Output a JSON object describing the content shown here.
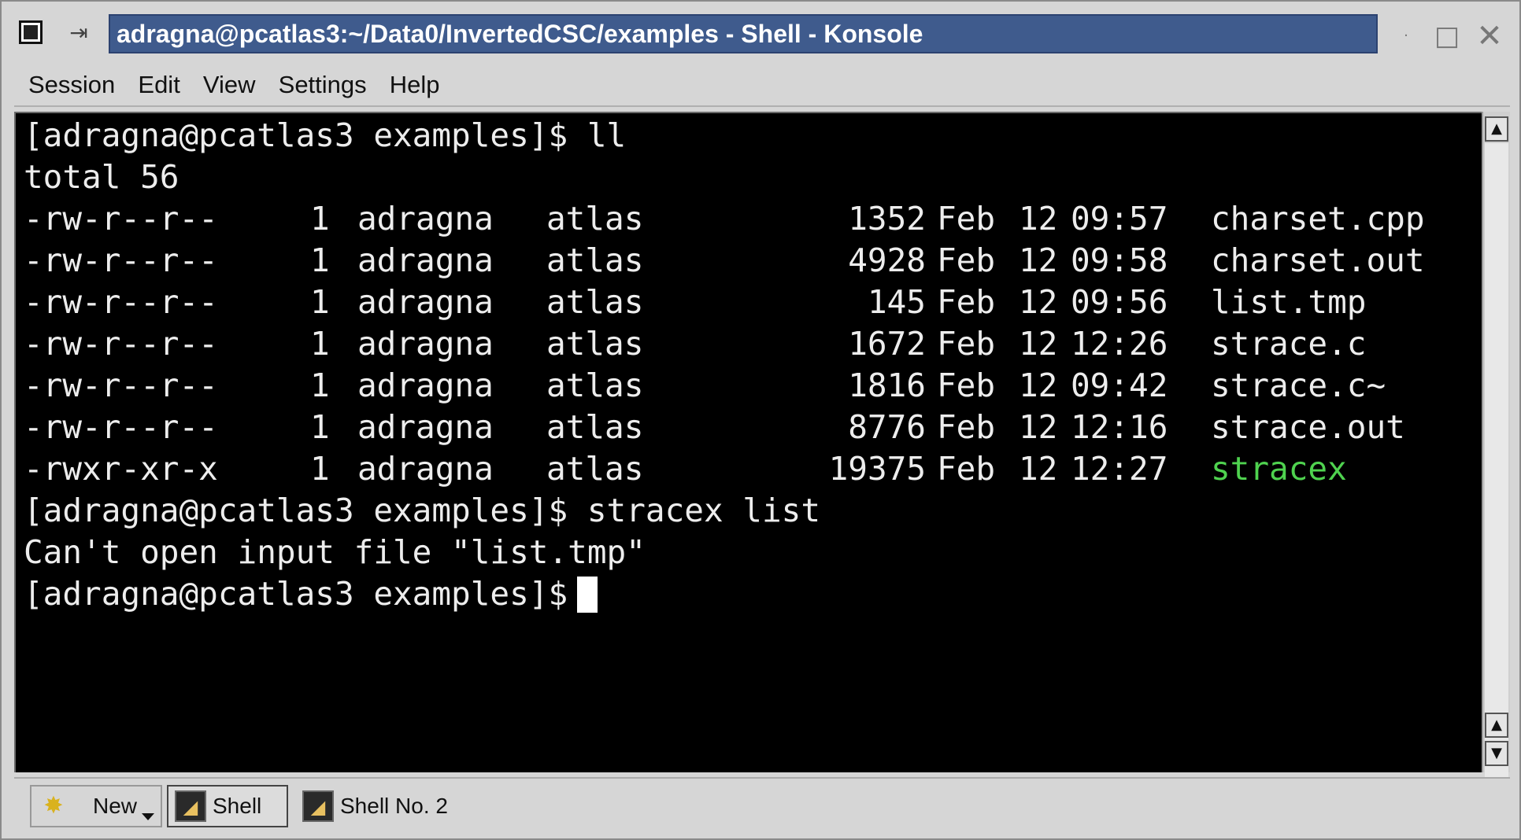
{
  "window": {
    "title": "adragna@pcatlas3:~/Data0/InvertedCSC/examples - Shell - Konsole",
    "minimize_glyph": "·",
    "maximize_glyph": "□",
    "close_glyph": "✕",
    "pin_glyph": "⇥"
  },
  "menu": [
    "Session",
    "Edit",
    "View",
    "Settings",
    "Help"
  ],
  "terminal": {
    "prompt_cmd1": "[adragna@pcatlas3 examples]$ ll",
    "total": "total 56",
    "files": [
      {
        "perm": "-rw-r--r--",
        "links": "1",
        "owner": "adragna",
        "group": "atlas",
        "size": "1352",
        "month": "Feb",
        "day": "12",
        "time": "09:57",
        "name": "charset.cpp"
      },
      {
        "perm": "-rw-r--r--",
        "links": "1",
        "owner": "adragna",
        "group": "atlas",
        "size": "4928",
        "month": "Feb",
        "day": "12",
        "time": "09:58",
        "name": "charset.out"
      },
      {
        "perm": "-rw-r--r--",
        "links": "1",
        "owner": "adragna",
        "group": "atlas",
        "size": "145",
        "month": "Feb",
        "day": "12",
        "time": "09:56",
        "name": "list.tmp"
      },
      {
        "perm": "-rw-r--r--",
        "links": "1",
        "owner": "adragna",
        "group": "atlas",
        "size": "1672",
        "month": "Feb",
        "day": "12",
        "time": "12:26",
        "name": "strace.c"
      },
      {
        "perm": "-rw-r--r--",
        "links": "1",
        "owner": "adragna",
        "group": "atlas",
        "size": "1816",
        "month": "Feb",
        "day": "12",
        "time": "09:42",
        "name": "strace.c~"
      },
      {
        "perm": "-rw-r--r--",
        "links": "1",
        "owner": "adragna",
        "group": "atlas",
        "size": "8776",
        "month": "Feb",
        "day": "12",
        "time": "12:16",
        "name": "strace.out"
      },
      {
        "perm": "-rwxr-xr-x",
        "links": "1",
        "owner": "adragna",
        "group": "atlas",
        "size": "19375",
        "month": "Feb",
        "day": "12",
        "time": "12:27",
        "name": "stracex"
      }
    ],
    "exec_color": "#4fd24f",
    "prompt_cmd2": "[adragna@pcatlas3 examples]$ stracex list",
    "error": "Can't open input file \"list.tmp\"",
    "prompt_current": "[adragna@pcatlas3 examples]$"
  },
  "scrollbar": {
    "up_glyph": "▲",
    "down_glyph": "▼"
  },
  "tabs": {
    "new_label": "New",
    "tab1_label": "Shell",
    "tab2_label": "Shell No. 2",
    "new_icon": "✸",
    "term_icon": "◢"
  }
}
